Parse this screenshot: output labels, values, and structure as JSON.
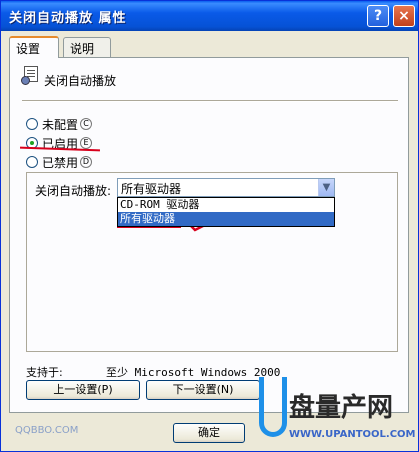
{
  "window": {
    "title": "关闭自动播放 属性",
    "help_label": "?",
    "close_label": "×"
  },
  "tabs": [
    {
      "label": "设置",
      "active": true
    },
    {
      "label": "说明",
      "active": false
    }
  ],
  "policy": {
    "name": "关闭自动播放",
    "icon": "policy-document-icon"
  },
  "radios": [
    {
      "label": "未配置",
      "accel": "C",
      "checked": false
    },
    {
      "label": "已启用",
      "accel": "E",
      "checked": true
    },
    {
      "label": "已禁用",
      "accel": "D",
      "checked": false
    }
  ],
  "options": {
    "label": "关闭自动播放:",
    "selected_value": "所有驱动器",
    "dropdown_items": [
      {
        "label": "CD-ROM 驱动器",
        "selected": false
      },
      {
        "label": "所有驱动器",
        "selected": true
      }
    ]
  },
  "support": {
    "label": "支持于:",
    "value": "至少 Microsoft Windows 2000"
  },
  "buttons": {
    "prev": "上一设置(P)",
    "next": "下一设置(N)",
    "ok": "确定"
  },
  "watermark": {
    "left_text": "QQBBO.COM",
    "logo_letter": "U",
    "logo_text": "盘量产网",
    "logo_url": "WWW.UPANTOOL.COM"
  },
  "colors": {
    "annotation_red": "#d8001c",
    "selection_blue": "#316ac5",
    "titlebar_blue": "#0a5ae8"
  }
}
